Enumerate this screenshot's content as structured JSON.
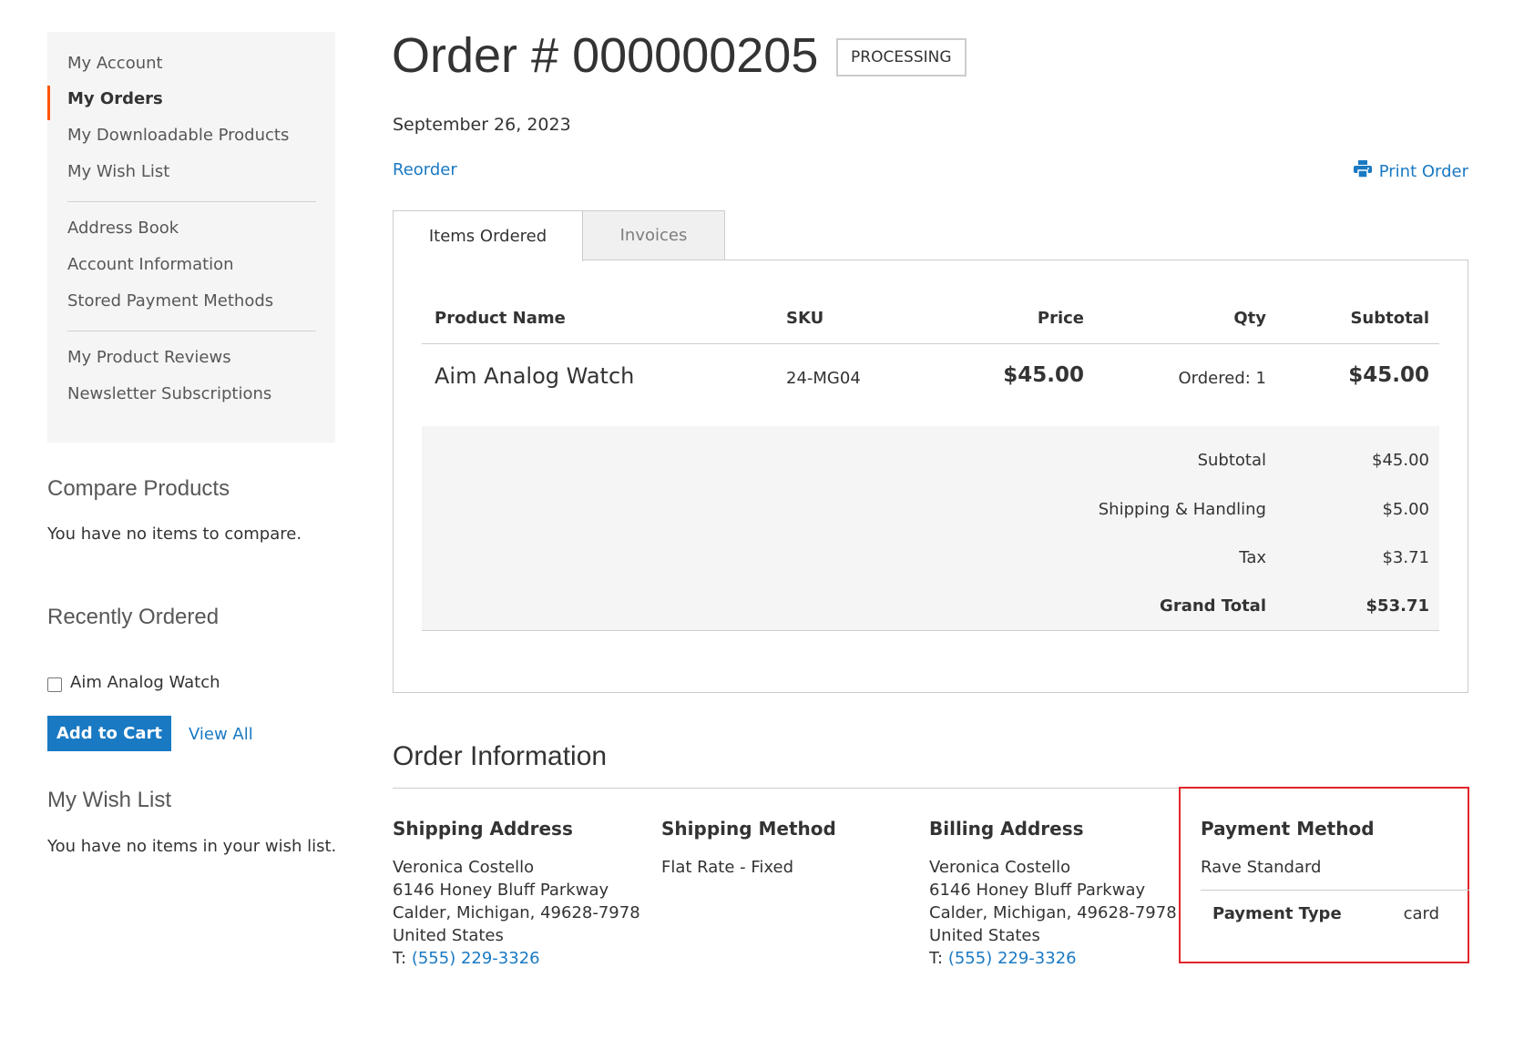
{
  "sidebar": {
    "nav_items": [
      {
        "label": "My Account"
      },
      {
        "label": "My Orders"
      },
      {
        "label": "My Downloadable Products"
      },
      {
        "label": "My Wish List"
      },
      {
        "label": "Address Book"
      },
      {
        "label": "Account Information"
      },
      {
        "label": "Stored Payment Methods"
      },
      {
        "label": "My Product Reviews"
      },
      {
        "label": "Newsletter Subscriptions"
      }
    ],
    "current_item": "My Orders",
    "compare": {
      "title": "Compare Products",
      "empty_text": "You have no items to compare."
    },
    "recently_ordered": {
      "title": "Recently Ordered",
      "item": "Aim Analog Watch",
      "item_checked": false,
      "add_to_cart": "Add to Cart",
      "view_all": "View All"
    },
    "wishlist": {
      "title": "My Wish List",
      "empty_text": "You have no items in your wish list."
    }
  },
  "header": {
    "title": "Order # 000000205",
    "status": "PROCESSING",
    "date": "September 26, 2023",
    "reorder": "Reorder",
    "print_order": "Print Order"
  },
  "tabs": [
    {
      "label": "Items Ordered",
      "active": true
    },
    {
      "label": "Invoices",
      "active": false
    }
  ],
  "items_table": {
    "headers": {
      "name": "Product Name",
      "sku": "SKU",
      "price": "Price",
      "qty": "Qty",
      "subtotal": "Subtotal"
    },
    "rows": [
      {
        "name": "Aim Analog Watch",
        "sku": "24-MG04",
        "price": "$45.00",
        "qty": "Ordered: 1",
        "subtotal": "$45.00"
      }
    ],
    "totals": [
      {
        "label": "Subtotal",
        "value": "$45.00"
      },
      {
        "label": "Shipping & Handling",
        "value": "$5.00"
      },
      {
        "label": "Tax",
        "value": "$3.71"
      },
      {
        "label": "Grand Total",
        "value": "$53.71"
      }
    ]
  },
  "order_info": {
    "title": "Order Information",
    "shipping_address": {
      "title": "Shipping Address",
      "name": "Veronica Costello",
      "street": "6146 Honey Bluff Parkway",
      "city": "Calder, Michigan, 49628-7978",
      "country": "United States",
      "phone_prefix": "T:",
      "phone": "(555) 229-3326"
    },
    "shipping_method": {
      "title": "Shipping Method",
      "value": "Flat Rate - Fixed"
    },
    "billing_address": {
      "title": "Billing Address",
      "name": "Veronica Costello",
      "street": "6146 Honey Bluff Parkway",
      "city": "Calder, Michigan, 49628-7978",
      "country": "United States",
      "phone_prefix": "T:",
      "phone": "(555) 229-3326"
    },
    "payment_method": {
      "title": "Payment Method",
      "value": "Rave Standard",
      "type_label": "Payment Type",
      "type_value": "card"
    }
  },
  "colors": {
    "link": "#1979c3",
    "nav_accent": "#ff5501",
    "highlight": "#e0252b",
    "button": "#1979c3"
  },
  "icons": {
    "print": "printer-icon"
  }
}
